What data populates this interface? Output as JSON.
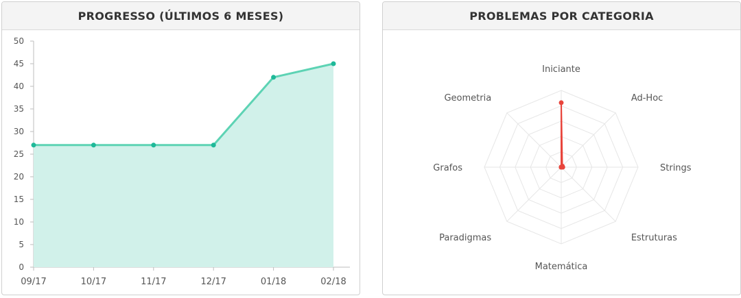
{
  "panels": {
    "progress": {
      "title": "PROGRESSO (ÚLTIMOS 6 MESES)"
    },
    "categories": {
      "title": "PROBLEMAS POR CATEGORIA"
    }
  },
  "colors": {
    "line": "#5dd3b4",
    "area": "#d1f1ea",
    "point": "#1fb999",
    "radar": "#e8453c",
    "grid": "#e6e6e6"
  },
  "chart_data": [
    {
      "type": "area",
      "categories": [
        "09/17",
        "10/17",
        "11/17",
        "12/17",
        "01/18",
        "02/18"
      ],
      "values": [
        27,
        27,
        27,
        27,
        42,
        45
      ],
      "ylim": [
        0,
        50
      ],
      "yticks": [
        0,
        5,
        10,
        15,
        20,
        25,
        30,
        35,
        40,
        45,
        50
      ],
      "grid": false
    },
    {
      "type": "radar",
      "axes": [
        "Iniciante",
        "Ad-Hoc",
        "Strings",
        "Estruturas",
        "Matemática",
        "Paradigmas",
        "Grafos",
        "Geometria"
      ],
      "values": [
        42,
        1,
        1,
        0,
        0,
        0,
        0,
        0
      ],
      "max": 50,
      "rings": 5
    }
  ]
}
